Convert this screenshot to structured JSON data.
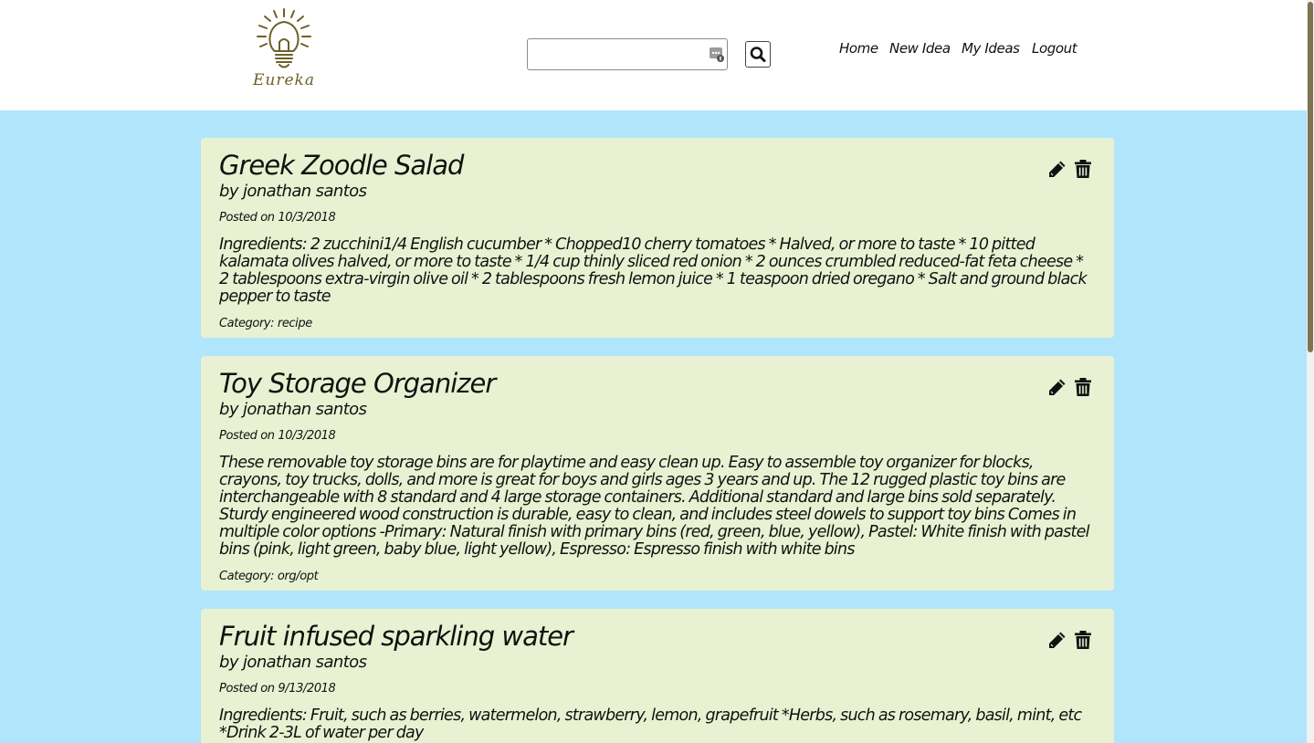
{
  "header": {
    "logo_text": "Eureka",
    "search": {
      "value": "",
      "placeholder": ""
    },
    "nav": [
      {
        "label": "Home"
      },
      {
        "label": "New Idea"
      },
      {
        "label": "My Ideas"
      },
      {
        "label": "Logout"
      }
    ]
  },
  "ideas": [
    {
      "title": "Greek Zoodle Salad",
      "author": "by jonathan santos",
      "posted": "Posted on 10/3/2018",
      "body": "Ingredients: 2 zucchini1/4 English cucumber * Chopped10 cherry tomatoes * Halved, or more to taste * 10 pitted kalamata olives halved, or more to taste * 1/4 cup thinly sliced red onion * 2 ounces crumbled reduced-fat feta cheese * 2 tablespoons extra-virgin olive oil * 2 tablespoons fresh lemon juice * 1 teaspoon dried oregano * Salt and ground black pepper to taste",
      "category": "Category: recipe"
    },
    {
      "title": "Toy Storage Organizer",
      "author": "by jonathan santos",
      "posted": "Posted on 10/3/2018",
      "body": "These removable toy storage bins are for playtime and easy clean up. Easy to assemble toy organizer for blocks, crayons, toy trucks, dolls, and more is great for boys and girls ages 3 years and up. The 12 rugged plastic toy bins are interchangeable with 8 standard and 4 large storage containers. Additional standard and large bins sold separately. Sturdy engineered wood construction is durable, easy to clean, and includes steel dowels to support toy bins Comes in multiple color options -Primary: Natural finish with primary bins (red, green, blue, yellow), Pastel: White finish with pastel bins (pink, light green, baby blue, light yellow), Espresso: Espresso finish with white bins",
      "category": "Category: org/opt"
    },
    {
      "title": "Fruit infused sparkling water",
      "author": "by jonathan santos",
      "posted": "Posted on 9/13/2018",
      "body": "Ingredients: Fruit, such as berries, watermelon, strawberry, lemon, grapefruit *Herbs, such as rosemary, basil, mint, etc *Drink 2-3L of water per day",
      "category": ""
    }
  ],
  "colors": {
    "page_background": "#b0e5fb",
    "card_background": "#e8f2d2",
    "logo": "#6b6028",
    "scrollbar_thumb": "#7d7451"
  },
  "icons": {
    "logo": "lightbulb-icon",
    "search_input_badge": "password-manager-icon",
    "search_button": "search-icon",
    "edit": "pencil-icon",
    "delete": "trash-icon"
  }
}
